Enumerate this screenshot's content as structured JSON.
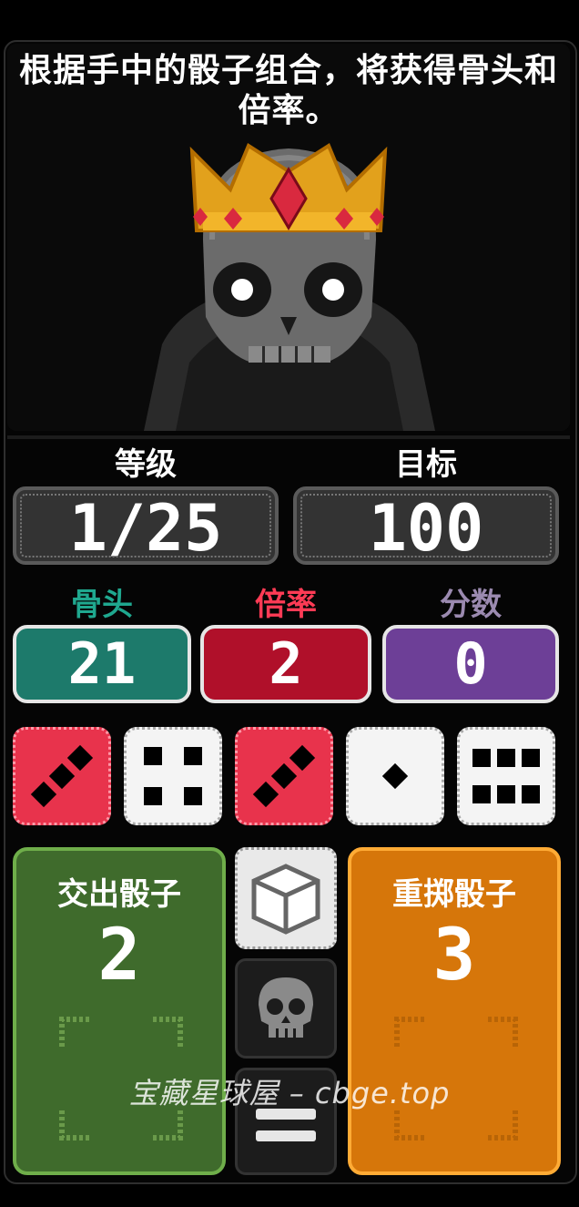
{
  "intro_text": "根据手中的骰子组合，将获得骨头和倍率。",
  "level": {
    "label": "等级",
    "value": "1/25"
  },
  "target": {
    "label": "目标",
    "value": "100"
  },
  "bones": {
    "label": "骨头",
    "value": "21",
    "color": "#1d7a6b"
  },
  "multiplier": {
    "label": "倍率",
    "value": "2",
    "color": "#b0102a"
  },
  "score": {
    "label": "分数",
    "value": "0",
    "color": "#6d3f97"
  },
  "dice": [
    {
      "value": 2,
      "color": "red"
    },
    {
      "value": 4,
      "color": "white"
    },
    {
      "value": 2,
      "color": "red"
    },
    {
      "value": 1,
      "color": "white"
    },
    {
      "value": 6,
      "color": "white"
    }
  ],
  "play_panel": {
    "title": "交出骰子",
    "count": "2",
    "color": "#3f6b2c"
  },
  "reroll_panel": {
    "title": "重掷骰子",
    "count": "3",
    "color": "#d6760a"
  },
  "icons": {
    "dice_bag": "cube-icon",
    "skull": "skull-icon",
    "menu": "menu-icon",
    "portrait": "crowned-skull-king"
  },
  "watermark": "宝藏星球屋 – cbge.top"
}
